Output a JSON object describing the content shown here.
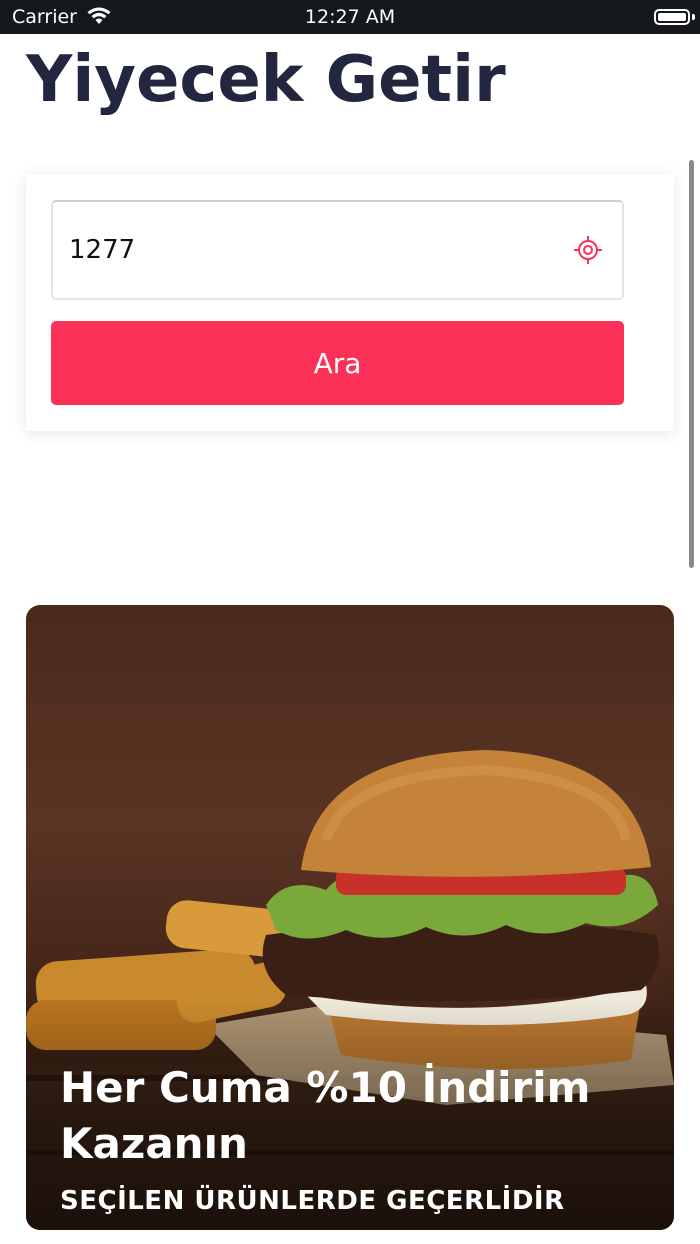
{
  "status_bar": {
    "carrier": "Carrier",
    "time": "12:27 AM"
  },
  "header": {
    "title": "Yiyecek Getir"
  },
  "search": {
    "zip_value": "1277",
    "button_label": "Ara",
    "accent_color": "#fb3158"
  },
  "promo": {
    "title": "Her Cuma %10 İndirim Kazanın",
    "subtitle": "SEÇİLEN ÜRÜNLERDE GEÇERLİDİR"
  },
  "colors": {
    "title": "#23263f",
    "accent": "#fb3158",
    "status_bar": "#15181c"
  },
  "icons": [
    "wifi-icon",
    "battery-icon",
    "location-target-icon",
    "burger-image"
  ]
}
